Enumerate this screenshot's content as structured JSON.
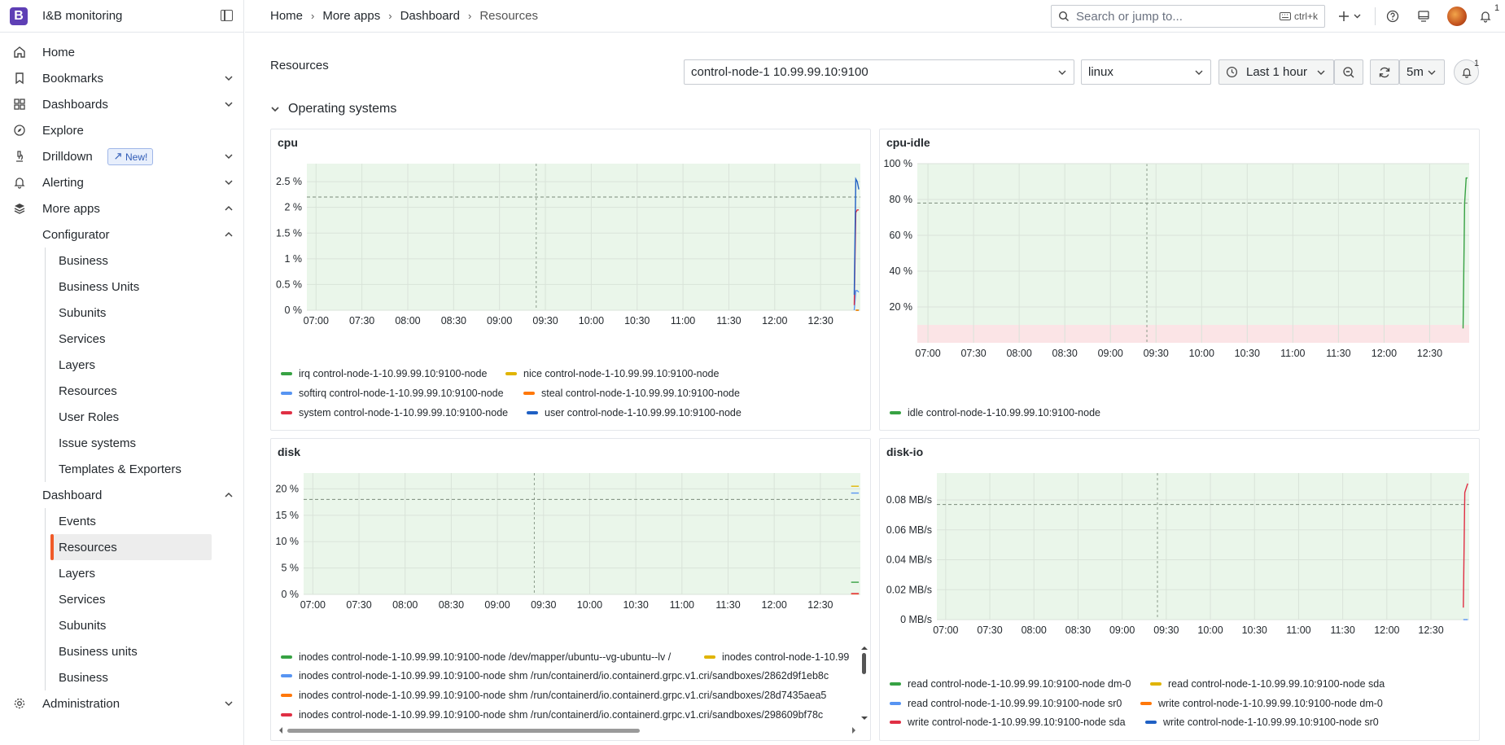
{
  "app": {
    "title": "I&B monitoring",
    "logo_letter": "B"
  },
  "sidebar": {
    "items": [
      {
        "label": "Home",
        "icon": "home-icon"
      },
      {
        "label": "Bookmarks",
        "icon": "bookmark-icon"
      },
      {
        "label": "Dashboards",
        "icon": "dashboards-icon"
      },
      {
        "label": "Explore",
        "icon": "compass-icon"
      },
      {
        "label": "Drilldown",
        "icon": "microscope-icon",
        "badge": "New!"
      },
      {
        "label": "Alerting",
        "icon": "bell-icon"
      },
      {
        "label": "More apps",
        "icon": "layers-icon"
      }
    ],
    "configurator": {
      "label": "Configurator",
      "items": [
        "Business",
        "Business Units",
        "Subunits",
        "Services",
        "Layers",
        "Resources",
        "User Roles",
        "Issue systems",
        "Templates & Exporters"
      ]
    },
    "dashboard": {
      "label": "Dashboard",
      "items": [
        "Events",
        "Resources",
        "Layers",
        "Services",
        "Subunits",
        "Business units",
        "Business"
      ],
      "active": "Resources"
    },
    "administration": {
      "label": "Administration",
      "icon": "gear-icon"
    }
  },
  "topbar": {
    "breadcrumbs": [
      "Home",
      "More apps",
      "Dashboard",
      "Resources"
    ],
    "search_placeholder": "Search or jump to...",
    "search_shortcut": "ctrl+k",
    "notification_count": "1"
  },
  "page": {
    "title": "Resources",
    "node_select": "control-node-1 10.99.99.10:9100",
    "os_select": "linux",
    "time_range": "Last 1 hour",
    "refresh_interval": "5m",
    "alert_count": "1",
    "row_title": "Operating systems"
  },
  "colors": {
    "green": "#37a243",
    "yellow": "#e0b400",
    "lightblue": "#5794f2",
    "orange": "#ff780a",
    "red": "#e02f44",
    "blue": "#1f60c4",
    "threshold_green": "#eaf6ea",
    "threshold_red": "#fbe4e6"
  },
  "panels": {
    "cpu": {
      "title": "cpu",
      "legend": [
        {
          "label": "irq control-node-1-10.99.99.10:9100-node",
          "color": "#37a243"
        },
        {
          "label": "nice control-node-1-10.99.99.10:9100-node",
          "color": "#e0b400"
        },
        {
          "label": "softirq control-node-1-10.99.99.10:9100-node",
          "color": "#5794f2"
        },
        {
          "label": "steal control-node-1-10.99.99.10:9100-node",
          "color": "#ff780a"
        },
        {
          "label": "system control-node-1-10.99.99.10:9100-node",
          "color": "#e02f44"
        },
        {
          "label": "user control-node-1-10.99.99.10:9100-node",
          "color": "#1f60c4"
        }
      ]
    },
    "cpu_idle": {
      "title": "cpu-idle",
      "legend": [
        {
          "label": "idle control-node-1-10.99.99.10:9100-node",
          "color": "#37a243"
        }
      ]
    },
    "disk": {
      "title": "disk",
      "legend": [
        {
          "label": "inodes control-node-1-10.99.99.10:9100-node /dev/mapper/ubuntu--vg-ubuntu--lv /",
          "color": "#37a243"
        },
        {
          "label": "inodes control-node-1-10.99",
          "color": "#e0b400"
        },
        {
          "label": "inodes control-node-1-10.99.99.10:9100-node shm /run/containerd/io.containerd.grpc.v1.cri/sandboxes/2862d9f1eb8c",
          "color": "#5794f2"
        },
        {
          "label": "inodes control-node-1-10.99.99.10:9100-node shm /run/containerd/io.containerd.grpc.v1.cri/sandboxes/28d7435aea5",
          "color": "#ff780a"
        },
        {
          "label": "inodes control-node-1-10.99.99.10:9100-node shm /run/containerd/io.containerd.grpc.v1.cri/sandboxes/298609bf78c",
          "color": "#e02f44"
        }
      ]
    },
    "disk_io": {
      "title": "disk-io",
      "legend": [
        {
          "label": "read control-node-1-10.99.99.10:9100-node dm-0",
          "color": "#37a243"
        },
        {
          "label": "read control-node-1-10.99.99.10:9100-node sda",
          "color": "#e0b400"
        },
        {
          "label": "read control-node-1-10.99.99.10:9100-node sr0",
          "color": "#5794f2"
        },
        {
          "label": "write control-node-1-10.99.99.10:9100-node dm-0",
          "color": "#ff780a"
        },
        {
          "label": "write control-node-1-10.99.99.10:9100-node sda",
          "color": "#e02f44"
        },
        {
          "label": "write control-node-1-10.99.99.10:9100-node sr0",
          "color": "#1f60c4"
        }
      ]
    }
  },
  "chart_data": [
    {
      "id": "cpu",
      "type": "line",
      "title": "cpu",
      "x_ticks": [
        "07:00",
        "07:30",
        "08:00",
        "08:30",
        "09:00",
        "09:30",
        "10:00",
        "10:30",
        "11:00",
        "11:30",
        "12:00",
        "12:30"
      ],
      "y_ticks": [
        "0 %",
        "0.5 %",
        "1 %",
        "1.5 %",
        "2 %",
        "2.5 %"
      ],
      "ylim": [
        0,
        2.85
      ],
      "threshold": 2.2,
      "series": [
        {
          "name": "irq control-node-1-10.99.99.10:9100-node",
          "color": "#37a243",
          "x": [
            "12:53",
            "12:55"
          ],
          "y": [
            0,
            0
          ]
        },
        {
          "name": "nice control-node-1-10.99.99.10:9100-node",
          "color": "#e0b400",
          "x": [
            "12:53",
            "12:55"
          ],
          "y": [
            0,
            0
          ]
        },
        {
          "name": "softirq control-node-1-10.99.99.10:9100-node",
          "color": "#5794f2",
          "x": [
            "12:52",
            "12:53",
            "12:54",
            "12:55"
          ],
          "y": [
            0,
            0.38,
            0.38,
            0.35
          ]
        },
        {
          "name": "steal control-node-1-10.99.99.10:9100-node",
          "color": "#ff780a",
          "x": [
            "12:53",
            "12:55"
          ],
          "y": [
            0,
            0
          ]
        },
        {
          "name": "system control-node-1-10.99.99.10:9100-node",
          "color": "#e02f44",
          "x": [
            "12:52",
            "12:53",
            "12:54",
            "12:55"
          ],
          "y": [
            0.1,
            1.9,
            1.95,
            1.95
          ]
        },
        {
          "name": "user control-node-1-10.99.99.10:9100-node",
          "color": "#1f60c4",
          "x": [
            "12:52",
            "12:53",
            "12:54",
            "12:55"
          ],
          "y": [
            0.3,
            2.55,
            2.5,
            2.35
          ]
        }
      ]
    },
    {
      "id": "cpu_idle",
      "type": "line",
      "title": "cpu-idle",
      "x_ticks": [
        "07:00",
        "07:30",
        "08:00",
        "08:30",
        "09:00",
        "09:30",
        "10:00",
        "10:30",
        "11:00",
        "11:30",
        "12:00",
        "12:30"
      ],
      "y_ticks": [
        "20 %",
        "40 %",
        "60 %",
        "80 %",
        "100 %"
      ],
      "ylim": [
        0,
        100
      ],
      "threshold": 78,
      "red_zone_max": 10,
      "series": [
        {
          "name": "idle control-node-1-10.99.99.10:9100-node",
          "color": "#37a243",
          "x": [
            "12:52",
            "12:53",
            "12:54",
            "12:55"
          ],
          "y": [
            8,
            78,
            92,
            92
          ]
        }
      ]
    },
    {
      "id": "disk",
      "type": "line",
      "title": "disk",
      "x_ticks": [
        "07:00",
        "07:30",
        "08:00",
        "08:30",
        "09:00",
        "09:30",
        "10:00",
        "10:30",
        "11:00",
        "11:30",
        "12:00",
        "12:30"
      ],
      "y_ticks": [
        "0 %",
        "5 %",
        "10 %",
        "15 %",
        "20 %"
      ],
      "ylim": [
        0,
        23
      ],
      "threshold": 18,
      "series": [
        {
          "name": "inodes control-node-1-10.99.99.10:9100-node /dev/mapper/ubuntu--vg-ubuntu--lv /",
          "color": "#37a243",
          "x": [
            "12:50",
            "12:55"
          ],
          "y": [
            2.3,
            2.3
          ]
        },
        {
          "name": "inodes control-node-1-10.99",
          "color": "#e0b400",
          "x": [
            "12:50",
            "12:55"
          ],
          "y": [
            20.5,
            20.5
          ]
        },
        {
          "name": "inodes control-node-1-10.99.99.10:9100-node shm /run/containerd/io.containerd.grpc.v1.cri/sandboxes/2862d9f1eb8c",
          "color": "#5794f2",
          "x": [
            "12:50",
            "12:55"
          ],
          "y": [
            19.2,
            19.2
          ]
        },
        {
          "name": "inodes control-node-1-10.99.99.10:9100-node shm /run/containerd/io.containerd.grpc.v1.cri/sandboxes/28d7435aea5",
          "color": "#ff780a",
          "x": [
            "12:50",
            "12:55"
          ],
          "y": [
            0.1,
            0.1
          ]
        },
        {
          "name": "inodes control-node-1-10.99.99.10:9100-node shm /run/containerd/io.containerd.grpc.v1.cri/sandboxes/298609bf78c",
          "color": "#e02f44",
          "x": [
            "12:50",
            "12:55"
          ],
          "y": [
            0.15,
            0.15
          ]
        }
      ]
    },
    {
      "id": "disk_io",
      "type": "line",
      "title": "disk-io",
      "x_ticks": [
        "07:00",
        "07:30",
        "08:00",
        "08:30",
        "09:00",
        "09:30",
        "10:00",
        "10:30",
        "11:00",
        "11:30",
        "12:00",
        "12:30"
      ],
      "y_ticks": [
        "0 MB/s",
        "0.02 MB/s",
        "0.04 MB/s",
        "0.06 MB/s",
        "0.08 MB/s"
      ],
      "ylim": [
        0,
        0.098
      ],
      "threshold": 0.077,
      "series": [
        {
          "name": "read control-node-1-10.99.99.10:9100-node sr0",
          "color": "#5794f2",
          "x": [
            "12:52",
            "12:55"
          ],
          "y": [
            0,
            0
          ]
        },
        {
          "name": "write control-node-1-10.99.99.10:9100-node sda",
          "color": "#e02f44",
          "x": [
            "12:52",
            "12:53",
            "12:54",
            "12:55"
          ],
          "y": [
            0.008,
            0.085,
            0.088,
            0.091
          ]
        }
      ]
    }
  ]
}
